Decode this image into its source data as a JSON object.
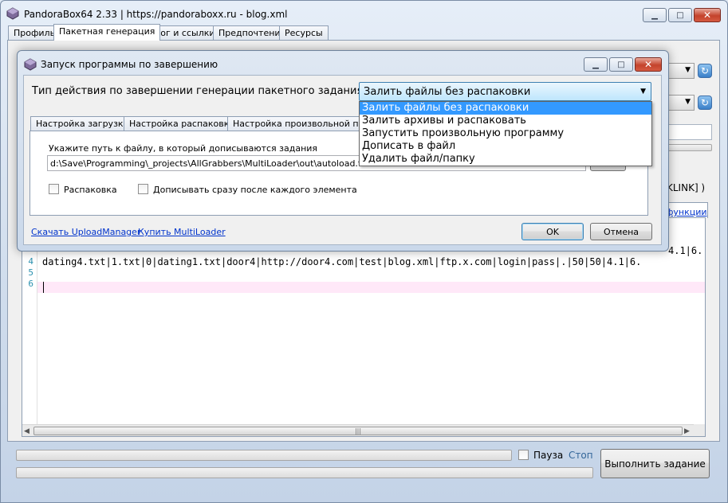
{
  "app": {
    "title": "PandoraBox64 2.33 | https://pandoraboxx.ru - blog.xml",
    "tabs": [
      "Профиль",
      "Пакетная генерация",
      "Лог и ссылки",
      "Предпочтения",
      "Ресурсы"
    ],
    "active_tab": 1
  },
  "background": {
    "partial_right_text": "KLINK] )",
    "partial_right_link": "функции",
    "code_lines": [
      {
        "num": "",
        "text": "4.1|6."
      },
      {
        "num": "4",
        "text": "dating4.txt|1.txt|0|dating1.txt|door4|http://door4.com|test|blog.xml|ftp.x.com|login|pass|.|50|50|4.1|6."
      },
      {
        "num": "5",
        "text": ""
      },
      {
        "num": "6",
        "text": ""
      }
    ],
    "pause_label": "Пауза",
    "stop_label": "Стоп",
    "run_button": "Выполнить задание"
  },
  "dialog": {
    "title": "Запуск программы по завершению",
    "action_label": "Тип действия по завершении генерации пакетного задания:",
    "action_value": "Залить файлы без распаковки",
    "action_options": [
      "Залить файлы без распаковки",
      "Залить архивы и распаковать",
      "Запустить произвольную программу",
      "Дописать в файл",
      "Удалить файл/папку"
    ],
    "action_selected_index": 0,
    "subtabs": [
      "Настройка загрузки",
      "Настройка распаковки",
      "Настройка произвольной прогр"
    ],
    "path_label": "Укажите путь к файлу, в который дописываются задания",
    "path_value": "d:\\Save\\Programming\\_projects\\AllGrabbers\\MultiLoader\\out\\autoload.txt",
    "checkbox_unpack": "Распаковка",
    "checkbox_append": "Дописывать сразу после каждого элемента",
    "link_download": "Скачать UploadManager",
    "link_buy": "Купить MultiLoader",
    "ok": "OK",
    "cancel": "Отмена"
  },
  "colors": {
    "accent": "#3399ff",
    "link": "#0033cc",
    "current_line": "#ffe8f8"
  }
}
